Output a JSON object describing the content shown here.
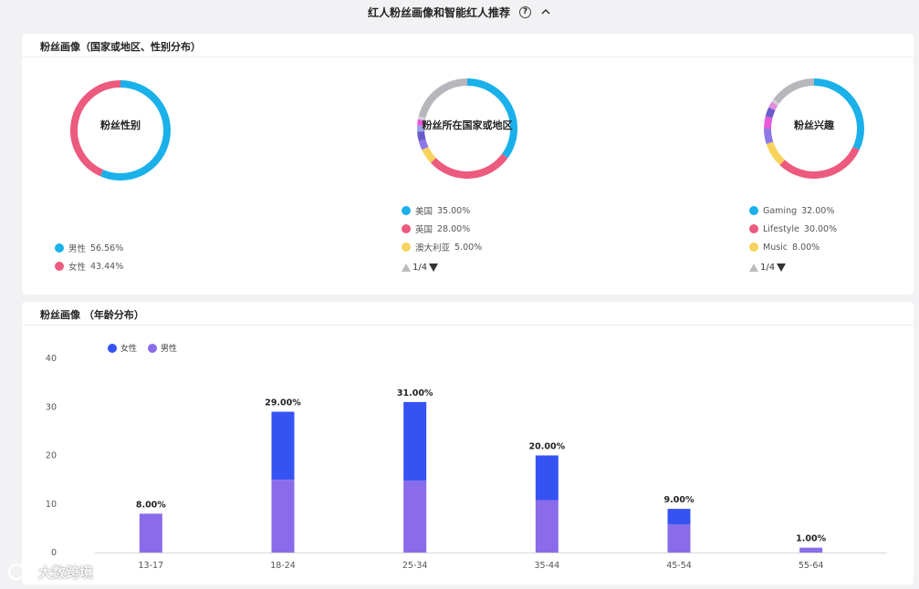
{
  "header": {
    "title": "红人粉丝画像和智能红人推荐",
    "help_glyph": "?"
  },
  "card1": {
    "title": "粉丝画像（国家或地区、性别分布）"
  },
  "card2": {
    "title": "粉丝画像 （年龄分布）"
  },
  "colors": {
    "blue": "#1ab0ea",
    "pink": "#ec5a7d",
    "yellow": "#f7d35d",
    "purple": "#8e78e6",
    "violet": "#6a5ccf",
    "magenta": "#e65bd8",
    "grey": "#b6b6bc",
    "female_bar": "#3553f2",
    "male_bar": "#8a6be9"
  },
  "chart_data": [
    {
      "type": "pie",
      "variant": "donut",
      "title": "粉丝性别",
      "categories": [
        "男性",
        "女性"
      ],
      "values": [
        56.56,
        43.44
      ],
      "value_labels": [
        "56.56%",
        "43.44%"
      ],
      "colors": [
        "#1ab0ea",
        "#ec5a7d"
      ]
    },
    {
      "type": "pie",
      "variant": "donut",
      "title": "粉丝所在国家或地区",
      "legend": [
        {
          "label": "美国",
          "value": "35.00%",
          "color": "#1ab0ea"
        },
        {
          "label": "英国",
          "value": "28.00%",
          "color": "#ec5a7d"
        },
        {
          "label": "澳大利亚",
          "value": "5.00%",
          "color": "#f7d35d"
        }
      ],
      "slices": [
        {
          "value": 35,
          "color": "#1ab0ea"
        },
        {
          "value": 28,
          "color": "#ec5a7d"
        },
        {
          "value": 5,
          "color": "#f7d35d"
        },
        {
          "value": 3,
          "color": "#8e78e6"
        },
        {
          "value": 3,
          "color": "#6a5ccf"
        },
        {
          "value": 2,
          "color": "#9aa4e8"
        },
        {
          "value": 2,
          "color": "#e65bd8"
        },
        {
          "value": 1,
          "color": "#d0d0d8"
        },
        {
          "value": 21,
          "color": "#b6b6bc"
        }
      ],
      "pager": "1/4"
    },
    {
      "type": "pie",
      "variant": "donut",
      "title": "粉丝兴趣",
      "legend": [
        {
          "label": "Gaming",
          "value": "32.00%",
          "color": "#1ab0ea"
        },
        {
          "label": "Lifestyle",
          "value": "30.00%",
          "color": "#ec5a7d"
        },
        {
          "label": "Music",
          "value": "8.00%",
          "color": "#f7d35d"
        }
      ],
      "slices": [
        {
          "value": 32,
          "color": "#1ab0ea"
        },
        {
          "value": 30,
          "color": "#ec5a7d"
        },
        {
          "value": 8,
          "color": "#f7d35d"
        },
        {
          "value": 5,
          "color": "#8e78e6"
        },
        {
          "value": 4,
          "color": "#e65bd8"
        },
        {
          "value": 3,
          "color": "#6a5ccf"
        },
        {
          "value": 2,
          "color": "#e58ad9"
        },
        {
          "value": 1,
          "color": "#d0d0d8"
        },
        {
          "value": 15,
          "color": "#b6b6bc"
        }
      ],
      "pager": "1/4"
    },
    {
      "type": "bar",
      "stacked": true,
      "categories": [
        "13-17",
        "18-24",
        "25-34",
        "35-44",
        "45-54",
        "55-64"
      ],
      "series": [
        {
          "name": "男性",
          "values": [
            8,
            15,
            14.8,
            10.8,
            5.8,
            1
          ],
          "color": "#8a6be9"
        },
        {
          "name": "女性",
          "values": [
            0,
            14,
            16.2,
            9.2,
            3.2,
            0
          ],
          "color": "#3553f2"
        }
      ],
      "total_labels": [
        "8.00%",
        "29.00%",
        "31.00%",
        "20.00%",
        "9.00%",
        "1.00%"
      ],
      "totals": [
        8,
        29,
        31,
        20,
        9,
        1
      ],
      "ylim": [
        0,
        40
      ],
      "yticks": [
        0,
        10,
        20,
        30,
        40
      ],
      "legend": [
        "女性",
        "男性"
      ],
      "legend_placement": "top-left",
      "grid": false
    }
  ],
  "watermark": {
    "text": "大数跨境"
  }
}
